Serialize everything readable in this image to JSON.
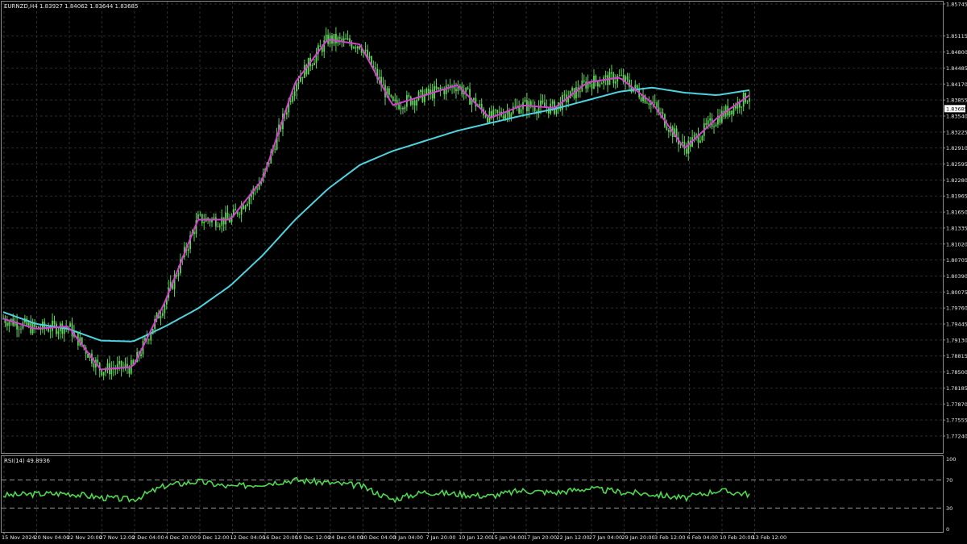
{
  "window": {
    "symbol_header": "EURNZD,H4  1.83927 1.84062 1.83644 1.83685"
  },
  "colors": {
    "background": "#000000",
    "grid": "#2b2b2b",
    "candle": "#5fd35a",
    "ma_fast": "#d63fd0",
    "ma_slow": "#4fd2e0",
    "rsi": "#4ed84e",
    "price_tag_bg": "#ffffff"
  },
  "price_axis": {
    "labels": [
      "1.85745",
      "1.85115",
      "1.84800",
      "1.84485",
      "1.84170",
      "1.83855",
      "1.83540",
      "1.83225",
      "1.82910",
      "1.82595",
      "1.82280",
      "1.81965",
      "1.81650",
      "1.81335",
      "1.81020",
      "1.80705",
      "1.80390",
      "1.80075",
      "1.79760",
      "1.79445",
      "1.79130",
      "1.78815",
      "1.78500",
      "1.78185",
      "1.77870",
      "1.77555",
      "1.77240"
    ],
    "current_price": "1.83685"
  },
  "rsi_panel": {
    "header": "RSI(14) 49.8936",
    "levels": [
      "100",
      "70",
      "30",
      "0"
    ]
  },
  "time_axis": {
    "labels": [
      "15 Nov 2024",
      "20 Nov 04:00",
      "22 Nov 20:00",
      "27 Nov 12:00",
      "2 Dec 04:00",
      "4 Dec 20:00",
      "9 Dec 12:00",
      "12 Dec 04:00",
      "16 Dec 20:00",
      "19 Dec 12:00",
      "24 Dec 04:00",
      "30 Dec 04:00",
      "3 Jan 04:00",
      "7 Jan 20:00",
      "10 Jan 12:00",
      "15 Jan 04:00",
      "17 Jan 20:00",
      "22 Jan 12:00",
      "27 Jan 04:00",
      "29 Jan 20:00",
      "3 Feb 12:00",
      "6 Feb 04:00",
      "10 Feb 20:00",
      "13 Feb 12:00"
    ]
  },
  "chart_data": {
    "type": "line",
    "symbol": "EURNZD",
    "timeframe": "H4",
    "ylim": [
      1.7724,
      1.85745
    ],
    "x": [
      "15 Nov 2024",
      "20 Nov 04:00",
      "22 Nov 20:00",
      "27 Nov 12:00",
      "2 Dec 04:00",
      "4 Dec 20:00",
      "9 Dec 12:00",
      "12 Dec 04:00",
      "16 Dec 20:00",
      "19 Dec 12:00",
      "24 Dec 04:00",
      "30 Dec 04:00",
      "3 Jan 04:00",
      "7 Jan 20:00",
      "10 Jan 12:00",
      "15 Jan 04:00",
      "17 Jan 20:00",
      "22 Jan 12:00",
      "27 Jan 04:00",
      "29 Jan 20:00",
      "3 Feb 12:00",
      "6 Feb 04:00",
      "10 Feb 20:00",
      "13 Feb 12:00"
    ],
    "series": [
      {
        "values": [
          1.7955,
          1.7935,
          1.794,
          1.7855,
          1.786,
          1.799,
          1.815,
          1.815,
          1.823,
          1.842,
          1.8505,
          1.8495,
          1.8375,
          1.8395,
          1.8415,
          1.835,
          1.8375,
          1.837,
          1.842,
          1.843,
          1.838,
          1.829,
          1.835,
          1.8395
        ]
      },
      {
        "values": [
          1.7968,
          1.7945,
          1.7935,
          1.7912,
          1.791,
          1.794,
          1.7975,
          1.802,
          1.808,
          1.815,
          1.821,
          1.8258,
          1.8285,
          1.8305,
          1.8325,
          1.834,
          1.8355,
          1.8368,
          1.8385,
          1.8402,
          1.841,
          1.84,
          1.8395,
          1.8405
        ]
      },
      {
        "values": [
          48,
          50,
          51,
          45,
          42,
          62,
          68,
          60,
          65,
          70,
          66,
          62,
          42,
          53,
          50,
          47,
          55,
          52,
          58,
          53,
          50,
          44,
          55,
          49.9
        ]
      }
    ]
  }
}
